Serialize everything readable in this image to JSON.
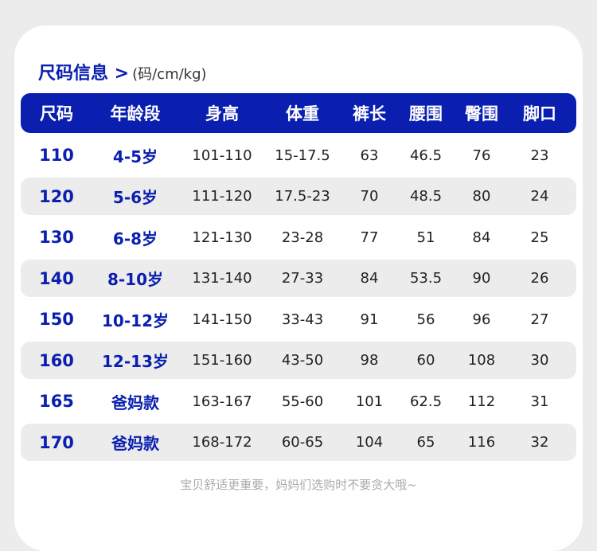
{
  "title": {
    "main": "尺码信息 >",
    "sub": "(码/cm/kg)"
  },
  "table": {
    "headers": [
      "尺码",
      "年龄段",
      "身高",
      "体重",
      "裤长",
      "腰围",
      "臀围",
      "脚口"
    ],
    "rows": [
      [
        "110",
        "4-5岁",
        "101-110",
        "15-17.5",
        "63",
        "46.5",
        "76",
        "23"
      ],
      [
        "120",
        "5-6岁",
        "111-120",
        "17.5-23",
        "70",
        "48.5",
        "80",
        "24"
      ],
      [
        "130",
        "6-8岁",
        "121-130",
        "23-28",
        "77",
        "51",
        "84",
        "25"
      ],
      [
        "140",
        "8-10岁",
        "131-140",
        "27-33",
        "84",
        "53.5",
        "90",
        "26"
      ],
      [
        "150",
        "10-12岁",
        "141-150",
        "33-43",
        "91",
        "56",
        "96",
        "27"
      ],
      [
        "160",
        "12-13岁",
        "151-160",
        "43-50",
        "98",
        "60",
        "108",
        "30"
      ],
      [
        "165",
        "爸妈款",
        "163-167",
        "55-60",
        "101",
        "62.5",
        "112",
        "31"
      ],
      [
        "170",
        "爸妈款",
        "168-172",
        "60-65",
        "104",
        "65",
        "116",
        "32"
      ]
    ]
  },
  "footer": "宝贝舒适更重要，妈妈们选购时不要贪大哦~",
  "colors": {
    "accent": "#0a1fb0",
    "row_alt": "#ececec",
    "text": "#222222",
    "footer_text": "#aaaaaa"
  }
}
